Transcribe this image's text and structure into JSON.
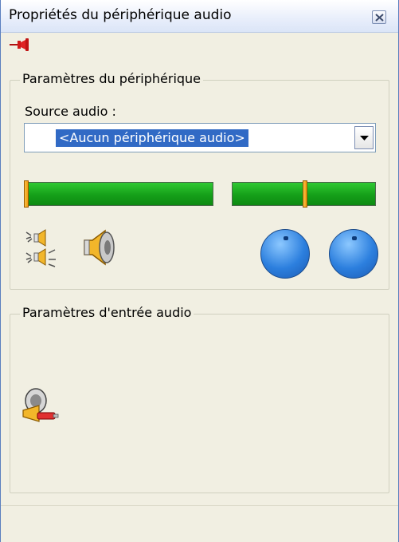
{
  "window": {
    "title": "Propriétés du périphérique audio",
    "close_icon": "close-icon"
  },
  "toolbar": {
    "pin_icon": "pushpin-icon"
  },
  "device_settings": {
    "legend": "Paramètres du périphérique",
    "source_label": "Source audio :",
    "source_value": "<Aucun périphérique audio>",
    "level_slider_value_pct": 0,
    "balance_slider_value_pct": 50,
    "icons": [
      "mute-speakers-icon",
      "speaker-icon",
      "volume-knob-icon",
      "volume-knob-icon"
    ]
  },
  "input_settings": {
    "legend": "Paramètres d'entrée audio",
    "icons": [
      "audio-input-icon"
    ]
  },
  "colors": {
    "slider_green": "#159f19",
    "thumb_orange": "#f59a0c",
    "knob_blue": "#2c7fde",
    "selection_blue": "#316ac5"
  }
}
